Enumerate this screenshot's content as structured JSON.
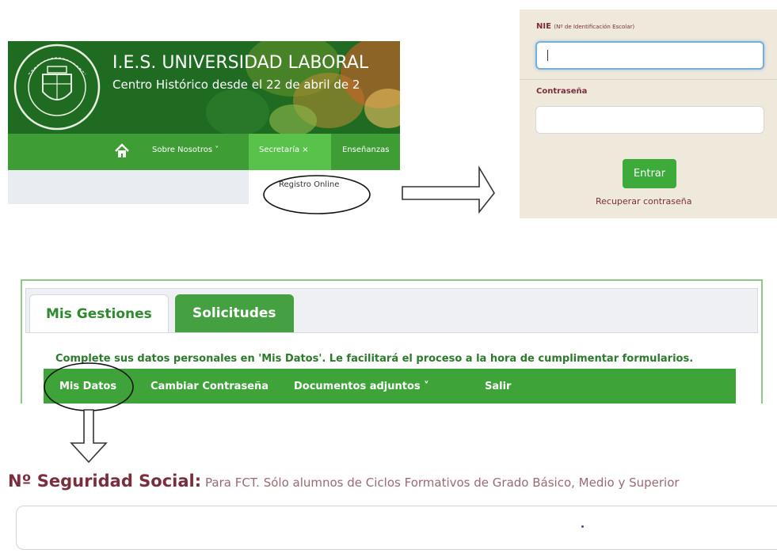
{
  "site": {
    "title": "I.E.S. UNIVERSIDAD LABORAL",
    "subtitle": "Centro Histórico desde el 22 de abril de 2",
    "seal_text": "Universidad Laboral Toledo",
    "nav": {
      "home_icon": "home-icon",
      "items": [
        {
          "label": "Sobre Nosotros ˅"
        },
        {
          "label": "Secretaría ×"
        },
        {
          "label": "Enseñanzas"
        }
      ]
    },
    "dropdown": {
      "item": "Registro Online"
    }
  },
  "login": {
    "nie_label": "NIE",
    "nie_note": "(Nº de Identificación Escolar)",
    "nie_value": "",
    "password_label": "Contraseña",
    "password_value": "",
    "enter_button": "Entrar",
    "recover_link": "Recuperar contraseña"
  },
  "user_area": {
    "tabs": [
      {
        "label": "Mis Gestiones",
        "active": true
      },
      {
        "label": "Solicitudes",
        "active": false
      }
    ],
    "notice": "Complete sus datos personales en 'Mis Datos'. Le facilitará el proceso a la hora de cumplimentar formularios.",
    "menu": [
      {
        "label": "Mis Datos"
      },
      {
        "label": "Cambiar Contraseña"
      },
      {
        "label": "Documentos adjuntos ˅"
      },
      {
        "label": "Salir"
      }
    ]
  },
  "social_security": {
    "label": "Nº Seguridad Social:",
    "note": "Para FCT. Sólo alumnos de Ciclos Formativos de Grado Básico, Medio y Superior",
    "value": ""
  },
  "colors": {
    "brand_green": "#3ea43a",
    "header_green": "#1f6b22",
    "label_maroon": "#7a2d3c",
    "login_bg": "#efe9dc"
  },
  "icons": [
    "home-icon",
    "right-arrow-icon",
    "down-arrow-icon",
    "seal-logo"
  ]
}
